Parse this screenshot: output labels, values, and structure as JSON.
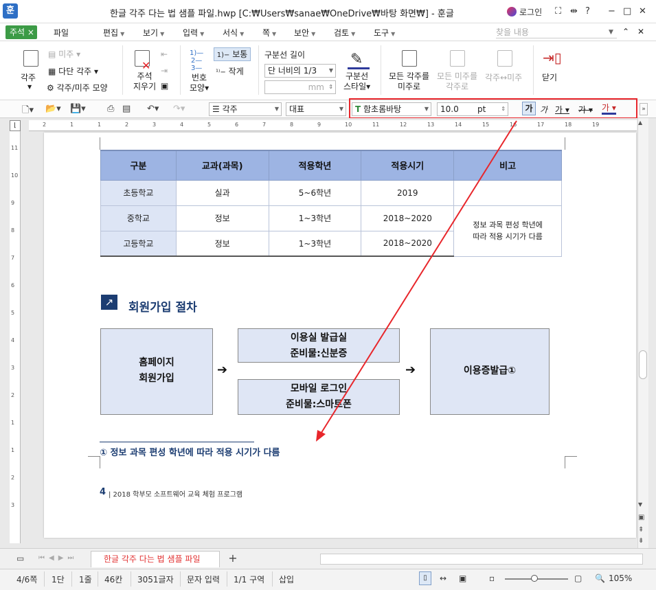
{
  "window": {
    "app_icon": "훈",
    "title": "한글 각주 다는 법 샘플 파일.hwp [C:₩Users₩sanae₩OneDrive₩바탕 화면₩] - 훈글",
    "login": "로그인",
    "buttons": {
      "help": "?",
      "minimize": "−",
      "maximize": "□",
      "close": "✕"
    }
  },
  "menu": {
    "active_tab": "주석",
    "active_tab_close": "×",
    "items": [
      "파일",
      "편집",
      "보기",
      "입력",
      "서식",
      "쪽",
      "보안",
      "검토",
      "도구"
    ],
    "search_placeholder": "찾을 내용"
  },
  "ribbon": {
    "footnote": "각주",
    "endnote": "미주",
    "multi_footnote": "다단 각주",
    "note_shape": "각주/미주 모양",
    "delete_note": "주석 지우기",
    "delete_note_l1": "주석",
    "delete_note_l2": "지우기",
    "number_shape_l1": "번호",
    "number_shape_l2": "모양",
    "style_normal": "보통",
    "style_small": "작게",
    "divider_length": "구분선 길이",
    "divider_value": "단 너비의 1/3",
    "mm_unit": "mm",
    "divider_style_l1": "구분선",
    "divider_style_l2": "스타일",
    "all_to_endnote_l1": "모든 각주를",
    "all_to_endnote_l2": "미주로",
    "all_to_footnote_l1": "모든 미주를",
    "all_to_footnote_l2": "각주로",
    "swap": "각주↔미주",
    "close": "닫기"
  },
  "toolbar2": {
    "style_combo": "각주",
    "lang_combo": "대표",
    "font_combo": "함초롬바탕",
    "font_size": "10.0",
    "size_unit": "pt",
    "bold": "가",
    "italic": "가",
    "underline": "가",
    "strike": "가",
    "color": "가"
  },
  "ruler": {
    "h_ticks": [
      "2",
      "1",
      "1",
      "2",
      "3",
      "4",
      "5",
      "6",
      "7",
      "8",
      "9",
      "10",
      "11",
      "12",
      "13",
      "14",
      "15",
      "16",
      "17",
      "18",
      "19"
    ],
    "v_ticks": [
      "11",
      "10",
      "9",
      "8",
      "7",
      "6",
      "5",
      "4",
      "3",
      "2",
      "1",
      "1",
      "2",
      "3"
    ]
  },
  "table": {
    "headers": [
      "구분",
      "교과(과목)",
      "적용학년",
      "적용시기",
      "비고"
    ],
    "rows": [
      [
        "초등학교",
        "실과",
        "5~6학년",
        "2019"
      ],
      [
        "중학교",
        "정보",
        "1~3학년",
        "2018~2020"
      ],
      [
        "고등학교",
        "정보",
        "1~3학년",
        "2018~2020"
      ]
    ],
    "note_line1": "정보 과목 편성 학년에",
    "note_line2": "따라 적용 시기가 다름"
  },
  "section": {
    "icon": "↗",
    "title": "회원가입 절차"
  },
  "process": {
    "box1_l1": "홈페이지",
    "box1_l2": "회원가입",
    "box2_l1": "이용실 발급실",
    "box2_l2": "준비물:신분증",
    "box3_l1": "모바일 로그인",
    "box3_l2": "준비물:스마트폰",
    "box4": "이용증발급①",
    "arrow": "➔"
  },
  "footnote_text": "① 정보 과목 편성 학년에 따라 적용 시기가 다름",
  "footer": {
    "page_number": "4",
    "text": "| 2018 학부모 소프트웨어 교육 체험 프로그램"
  },
  "tabs": {
    "doc_tab": "한글 각주 다는 법 샘플 파일",
    "add": "+"
  },
  "status": {
    "page": "4/6쪽",
    "column": "1단",
    "line": "1줄",
    "col_pos": "46칸",
    "chars": "3051글자",
    "mode": "문자 입력",
    "section": "1/1 구역",
    "insert": "삽입",
    "zoom": "105%"
  },
  "colors": {
    "highlight_box": "#e8262b",
    "annotation_arrow": "#e8262b",
    "header_blue": "#9db4e3",
    "navy": "#1c3d72",
    "tab_green": "#3c9b46"
  }
}
